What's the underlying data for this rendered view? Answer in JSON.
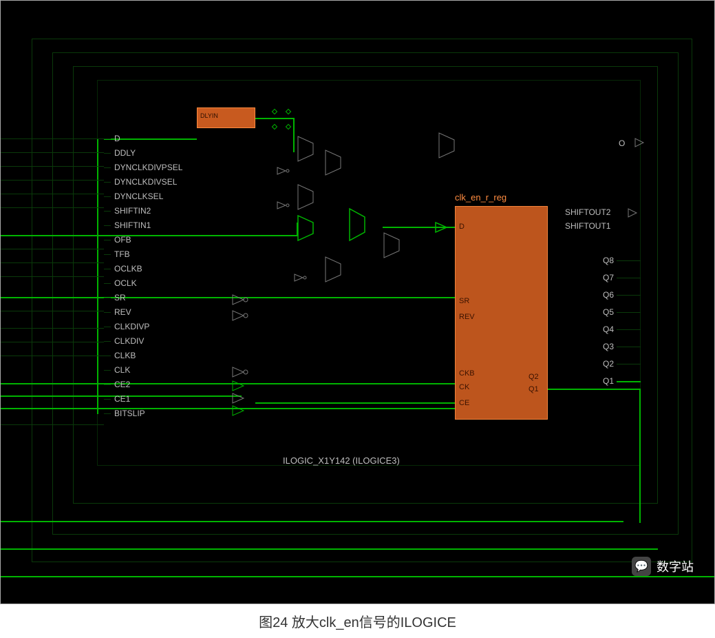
{
  "caption": "图24 放大clk_en信号的ILOGICE",
  "watermark": "数字站",
  "block_label": "ILOGIC_X1Y142 (ILOGICE3)",
  "reg_title": "clk_en_r_reg",
  "input_pins": [
    "D",
    "DDLY",
    "DYNCLKDIVPSEL",
    "DYNCLKDIVSEL",
    "DYNCLKSEL",
    "SHIFTIN2",
    "SHIFTIN1",
    "OFB",
    "TFB",
    "OCLKB",
    "OCLK",
    "SR",
    "REV",
    "CLKDIVP",
    "CLKDIV",
    "CLKB",
    "CLK",
    "CE2",
    "CE1",
    "BITSLIP"
  ],
  "reg_inputs": [
    "D",
    "SR",
    "REV",
    "CKB",
    "CK",
    "CE"
  ],
  "reg_outputs_inside": [
    "Q2",
    "Q1"
  ],
  "output_pins_top": [
    "O"
  ],
  "output_pins_shift": [
    "SHIFTOUT2",
    "SHIFTOUT1"
  ],
  "output_pins_q": [
    "Q8",
    "Q7",
    "Q6",
    "Q5",
    "Q4",
    "Q3",
    "Q2",
    "Q1"
  ],
  "delay_label": "DLYIN"
}
